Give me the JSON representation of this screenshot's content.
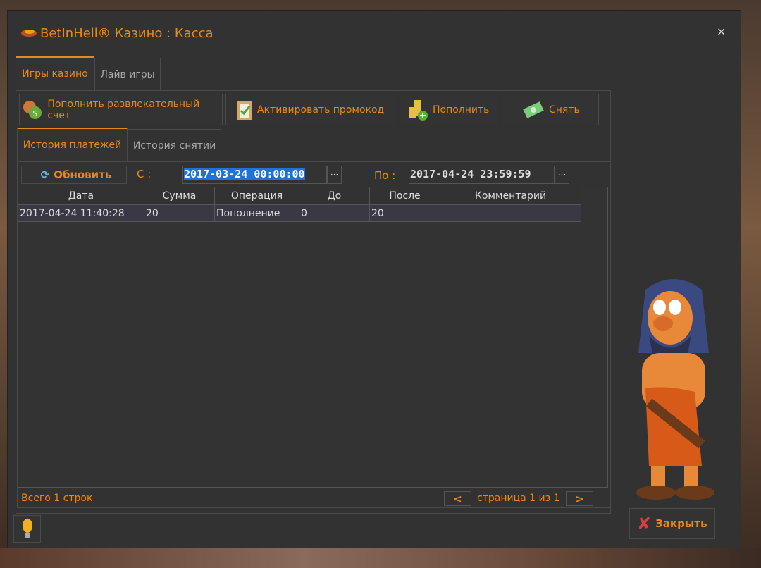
{
  "window": {
    "title": "BetInHell® Казино : Касса",
    "close": "×"
  },
  "tabs": [
    {
      "label": "Игры казино",
      "active": true
    },
    {
      "label": "Лайв игры",
      "active": false
    }
  ],
  "actions": {
    "deposit_entertainment": "Пополнить развлекательный счет",
    "activate_promo": "Активировать промокод",
    "deposit": "Пополнить",
    "withdraw": "Снять"
  },
  "subtabs": [
    {
      "label": "История платежей",
      "active": true
    },
    {
      "label": "История снятий",
      "active": false
    }
  ],
  "filter": {
    "refresh": "Обновить",
    "from_label": "С :",
    "from_value": "2017-03-24 00:00:00",
    "to_label": "По :",
    "to_value": "2017-04-24 23:59:59",
    "picker": "···"
  },
  "table": {
    "headers": [
      "Дата",
      "Сумма",
      "Операция",
      "До",
      "После",
      "Комментарий"
    ],
    "rows": [
      [
        "2017-04-24 11:40:28",
        "20",
        "Пополнение",
        "0",
        "20",
        ""
      ]
    ]
  },
  "footer": {
    "total": "Всего 1 строк",
    "prev": "<",
    "page": "страница 1 из 1",
    "next": ">"
  },
  "close_button": "Закрыть",
  "colors": {
    "accent": "#e8891c",
    "bg": "#323232"
  }
}
